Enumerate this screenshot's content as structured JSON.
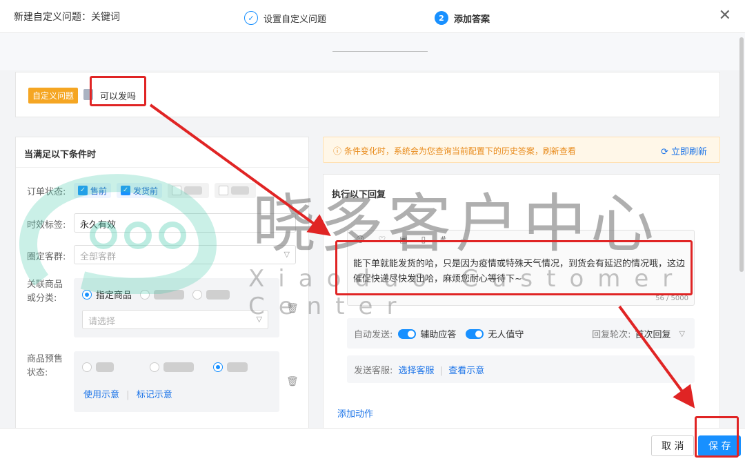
{
  "dialog": {
    "title": "新建自定义问题：关键词"
  },
  "steps": [
    {
      "number": "✓",
      "label": "设置自定义问题"
    },
    {
      "number": "2",
      "label": "添加答案"
    }
  ],
  "question": {
    "tag": "自定义问题",
    "text": "可以发吗"
  },
  "conditions": {
    "heading": "当满足以下条件时",
    "order_status_label": "订单状态:",
    "order_status_options": [
      "售前",
      "发货前"
    ],
    "validity_label": "时效标签:",
    "validity_value": "永久有效",
    "customer_group_label": "圈定客群:",
    "customer_group_placeholder": "全部客群",
    "product_label": "关联商品或分类:",
    "product_option": "指定商品",
    "product_placeholder": "请选择",
    "presale_label": "商品预售状态:",
    "presale_link1": "使用示意",
    "presale_link2": "标记示意"
  },
  "notice": {
    "text": "条件变化时，系统会为您查询当前配置下的历史答案，刷新查看",
    "refresh": "立即刷新"
  },
  "reply": {
    "heading": "执行以下回复",
    "text": "能下单就能发货的哈，只是因为疫情或特殊天气情况，到货会有延迟的情况哦，这边催促快递尽快发出哈，麻烦您耐心等待下~",
    "count": "56 / 5000",
    "auto_send_label": "自动发送:",
    "toggle1": "辅助应答",
    "toggle2": "无人值守",
    "round_label": "回复轮次:",
    "round_value": "首次回复",
    "send_service_label": "发送客服:",
    "select_service": "选择客服",
    "view_example": "查看示意",
    "add_action": "添加动作"
  },
  "footer": {
    "cancel": "取 消",
    "save": "保 存"
  },
  "watermark": {
    "cn": "晓多客户中心",
    "en": "Xiaoduo Customer Center"
  },
  "colors": {
    "primary": "#1890ff",
    "tag": "#f5a623",
    "annotation": "#e02424"
  }
}
